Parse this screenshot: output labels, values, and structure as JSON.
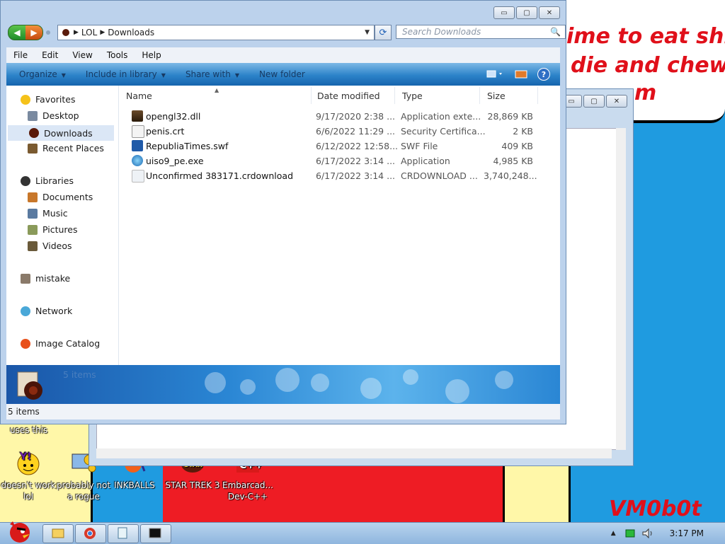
{
  "desktop": {
    "scribble_line1": "ime to eat shit",
    "scribble_line2": "die and chew",
    "scribble_line3": "m",
    "signature": "VM0b0t",
    "uses_this_label": "uses this",
    "icons": [
      {
        "label": "doesn't work lol"
      },
      {
        "label": "probably not a rogue"
      },
      {
        "label": "INKBALLS"
      },
      {
        "label": "STAR TREK 3"
      },
      {
        "label": "Embarcad... Dev-C++"
      }
    ]
  },
  "window": {
    "minimize": "▭",
    "maximize": "▢",
    "close": "✕",
    "nav": {
      "back": "◀",
      "forward": "▶",
      "breadcrumb": [
        "LOL",
        "Downloads"
      ],
      "refresh": "⟳",
      "search_placeholder": "Search Downloads"
    },
    "menu": [
      "File",
      "Edit",
      "View",
      "Tools",
      "Help"
    ],
    "toolbar": [
      "Organize",
      "Include in library",
      "Share with",
      "New folder"
    ],
    "sidebar": {
      "favorites_header": "Favorites",
      "favorites": [
        "Desktop",
        "Downloads",
        "Recent Places"
      ],
      "libraries_header": "Libraries",
      "libraries": [
        "Documents",
        "Music",
        "Pictures",
        "Videos"
      ],
      "mistake": "mistake",
      "network": "Network",
      "image_catalog": "Image Catalog"
    },
    "columns": [
      "Name",
      "Date modified",
      "Type",
      "Size"
    ],
    "files": [
      {
        "name": "opengl32.dll",
        "date": "9/17/2020 2:38 ...",
        "type": "Application exte...",
        "size": "28,869 KB"
      },
      {
        "name": "penis.crt",
        "date": "6/6/2022 11:29 ...",
        "type": "Security Certifica...",
        "size": "2 KB"
      },
      {
        "name": "RepubliaTimes.swf",
        "date": "6/12/2022 12:58...",
        "type": "SWF File",
        "size": "409 KB"
      },
      {
        "name": "uiso9_pe.exe",
        "date": "6/17/2022 3:14 ...",
        "type": "Application",
        "size": "4,985 KB"
      },
      {
        "name": "Unconfirmed 383171.crdownload",
        "date": "6/17/2022 3:14 ...",
        "type": "CRDOWNLOAD ...",
        "size": "3,740,248..."
      }
    ],
    "details_count": "5 items",
    "status_count": "5 items"
  },
  "taskbar": {
    "clock": "3:17 PM"
  },
  "colors": {
    "desktop_blue": "#1f9be0",
    "scribble_red": "#e0101a",
    "toolbar_blue": "#2c83c9"
  }
}
